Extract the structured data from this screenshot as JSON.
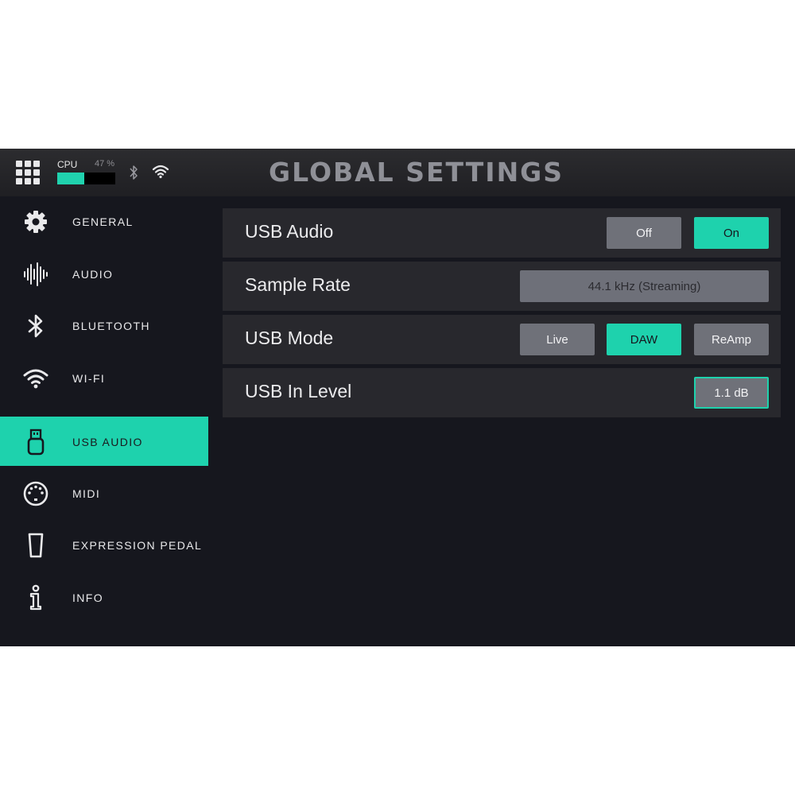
{
  "header": {
    "title": "GLOBAL SETTINGS",
    "cpu_label": "CPU",
    "cpu_value": "47 %",
    "cpu_fraction": 0.47,
    "icons": [
      "menu-grid-icon",
      "bluetooth-icon",
      "wifi-icon"
    ]
  },
  "sidebar": {
    "items": [
      {
        "label": "GENERAL",
        "icon": "gear-icon"
      },
      {
        "label": "AUDIO",
        "icon": "waveform-icon"
      },
      {
        "label": "BLUETOOTH",
        "icon": "bluetooth-icon"
      },
      {
        "label": "WI-FI",
        "icon": "wifi-icon"
      },
      {
        "label": "USB AUDIO",
        "icon": "usb-icon",
        "active": true
      },
      {
        "label": "MIDI",
        "icon": "midi-connector-icon"
      },
      {
        "label": "EXPRESSION PEDAL",
        "icon": "pedal-icon"
      },
      {
        "label": "INFO",
        "icon": "info-icon"
      }
    ]
  },
  "settings": {
    "usb_audio": {
      "label": "USB Audio",
      "options": [
        "Off",
        "On"
      ],
      "selected": "On"
    },
    "sample_rate": {
      "label": "Sample Rate",
      "value": "44.1 kHz (Streaming)"
    },
    "usb_mode": {
      "label": "USB Mode",
      "options": [
        "Live",
        "DAW",
        "ReAmp"
      ],
      "selected": "DAW"
    },
    "usb_in_level": {
      "label": "USB In Level",
      "value": "1.1 dB"
    }
  },
  "colors": {
    "accent": "#1ed2ad",
    "background": "#16171e",
    "row": "#28282d",
    "button": "#6f7179"
  }
}
